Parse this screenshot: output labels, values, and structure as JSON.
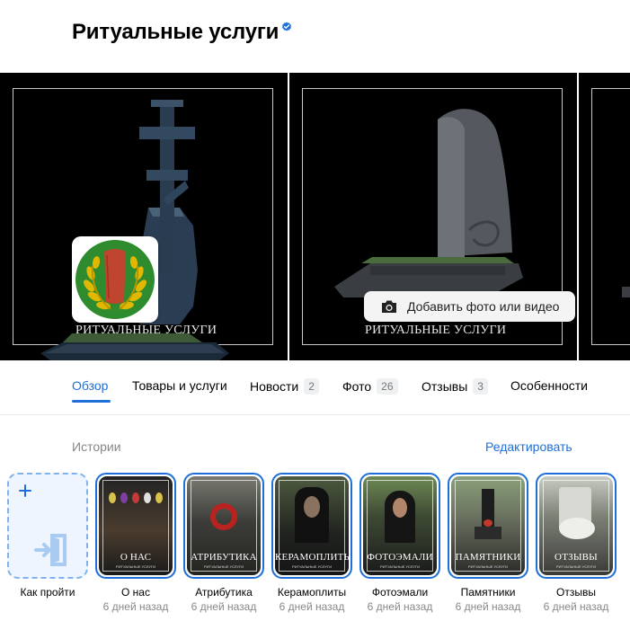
{
  "header": {
    "title": "Ритуальные услуги"
  },
  "gallery": {
    "photos": [
      {
        "caption": "РИТУАЛЬНЫЕ УСЛУГИ",
        "subject": "cross-monument"
      },
      {
        "caption": "РИТУАЛЬНЫЕ УСЛУГИ",
        "subject": "stele-monument"
      }
    ],
    "add_media_label": "Добавить фото или видео"
  },
  "tabs": [
    {
      "label": "Обзор",
      "active": true
    },
    {
      "label": "Товары и услуги"
    },
    {
      "label": "Новости",
      "count": "2"
    },
    {
      "label": "Фото",
      "count": "26"
    },
    {
      "label": "Отзывы",
      "count": "3"
    },
    {
      "label": "Особенности"
    }
  ],
  "stories": {
    "title": "Истории",
    "edit_label": "Редактировать",
    "add_label": "Как пройти",
    "items": [
      {
        "name": "О нас",
        "time": "6 дней назад",
        "thumb_caption": "О НАС",
        "thumb_sub": "РИТУАЛЬНЫЕ УСЛУГИ"
      },
      {
        "name": "Атрибутика",
        "time": "6 дней назад",
        "thumb_caption": "АТРИБУТИКА",
        "thumb_sub": "РИТУАЛЬНЫЕ УСЛУГИ"
      },
      {
        "name": "Керамоплиты",
        "time": "6 дней назад",
        "thumb_caption": "КЕРАМОПЛИТЫ",
        "thumb_sub": "РИТУАЛЬНЫЕ УСЛУГИ"
      },
      {
        "name": "Фотоэмали",
        "time": "6 дней назад",
        "thumb_caption": "ФОТОЭМАЛИ",
        "thumb_sub": "РИТУАЛЬНЫЕ УСЛУГИ"
      },
      {
        "name": "Памятники",
        "time": "6 дней назад",
        "thumb_caption": "ПАМЯТНИКИ",
        "thumb_sub": "РИТУАЛЬНЫЕ УСЛУГИ"
      },
      {
        "name": "Отзывы",
        "time": "6 дней назад",
        "thumb_caption": "ОТЗЫВЫ",
        "thumb_sub": "РИТУАЛЬНЫЕ УСЛУГИ"
      }
    ]
  },
  "colors": {
    "accent": "#1e6fd9",
    "verified": "#1e6fd9",
    "logo_green": "#2e8b2e",
    "logo_red": "#c0452e",
    "logo_gold": "#e0b800"
  },
  "icons": {
    "verified": "verified-check-icon",
    "camera": "camera-icon",
    "plus": "plus-icon",
    "route": "door-enter-icon"
  }
}
